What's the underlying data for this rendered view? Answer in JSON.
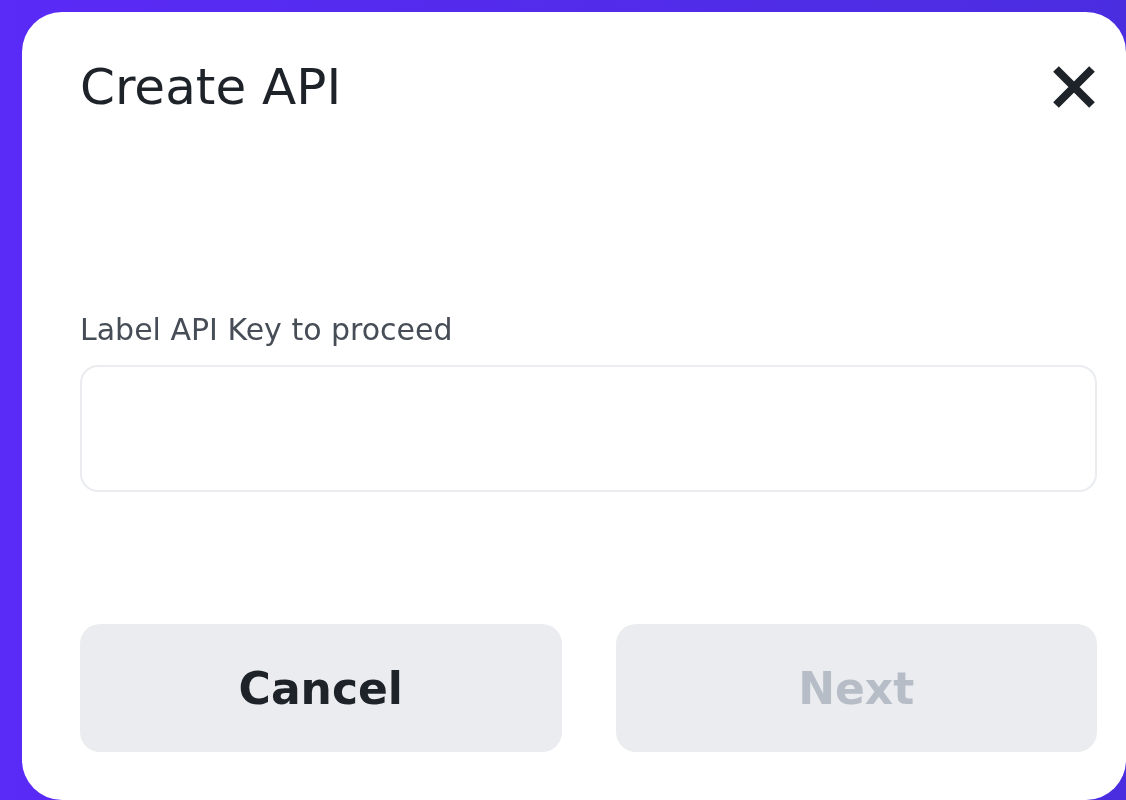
{
  "dialog": {
    "title": "Create API"
  },
  "field": {
    "label": "Label API Key to proceed"
  },
  "buttons": [
    {
      "label": "Cancel",
      "disabled": false
    },
    {
      "label": "Next",
      "disabled": true
    }
  ]
}
